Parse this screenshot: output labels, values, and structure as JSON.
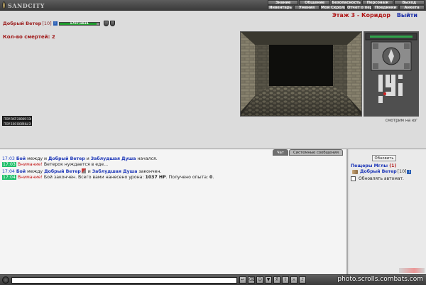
{
  "app": {
    "logo_text": "SANDCITY"
  },
  "menu": {
    "row1": [
      "Знание",
      "Общение",
      "Безопасность",
      "Персонаж",
      "Выход"
    ],
    "row2": [
      "Инвентарь",
      "Умения",
      "Мой Скролл",
      "Отчет о переводах",
      "Поединки",
      "Анкета"
    ]
  },
  "player": {
    "name": "Добрый Ветер",
    "level": "[10]",
    "info_badge": "i",
    "hp_text": "1707/1831",
    "hp_fraction": 0.93
  },
  "deaths": {
    "label": "Кол-во смертей:",
    "value": "2"
  },
  "counters": [
    "TOP RAT 20069 1366",
    "TOP 100 ВОЙНЫ 28149"
  ],
  "location": {
    "name": "Этаж 3 - Коридор",
    "exit": "Выйти"
  },
  "facing": "смотрим на юг",
  "chat_tabs": {
    "chat": "Чат",
    "system": "Системные сообщения"
  },
  "chat": [
    {
      "time": "17:03",
      "time_style": "blue",
      "parts": [
        {
          "t": "Бой",
          "s": "blue"
        },
        {
          "t": " между и ",
          "s": ""
        },
        {
          "t": "Добрый Ветер",
          "s": "blue"
        },
        {
          "t": " и ",
          "s": ""
        },
        {
          "t": "Заблудшая Душа",
          "s": "blue"
        },
        {
          "t": " начался.",
          "s": ""
        }
      ]
    },
    {
      "time": "17:03",
      "time_style": "hl",
      "parts": [
        {
          "t": "Внимание!",
          "s": "red"
        },
        {
          "t": " Ветерок нуждается в еде...",
          "s": ""
        }
      ]
    },
    {
      "time": "17:04",
      "time_style": "blue",
      "parts": [
        {
          "t": "Бой",
          "s": "blue"
        },
        {
          "t": " между ",
          "s": ""
        },
        {
          "t": "Добрый Ветер",
          "s": "blue"
        },
        {
          "t": "",
          "s": "weapon"
        },
        {
          "t": " и ",
          "s": ""
        },
        {
          "t": "Заблудшая Душа",
          "s": "blue"
        },
        {
          "t": " закончен.",
          "s": ""
        }
      ]
    },
    {
      "time": "17:04",
      "time_style": "hl",
      "parts": [
        {
          "t": "Внимание!",
          "s": "red"
        },
        {
          "t": " Бой закончен. Всего вами нанесено урона: ",
          "s": ""
        },
        {
          "t": "1037 HP",
          "s": "bold"
        },
        {
          "t": ". Получено опыта: ",
          "s": ""
        },
        {
          "t": "0",
          "s": "bold"
        },
        {
          "t": ".",
          "s": ""
        }
      ]
    }
  ],
  "room": {
    "refresh_label": "Обновить",
    "title": "Пещеры Мглы",
    "count": "(1)",
    "player_name": "Добрый Ветер",
    "player_level": "[10]",
    "info_badge": "i",
    "auto_refresh": "Обновлять автомат."
  },
  "watermark": "photo.scrolls.combats.com",
  "colors": {
    "hp_green": "#1f9a2d",
    "accent_red": "#b01515",
    "link_blue": "#1c36b8"
  }
}
